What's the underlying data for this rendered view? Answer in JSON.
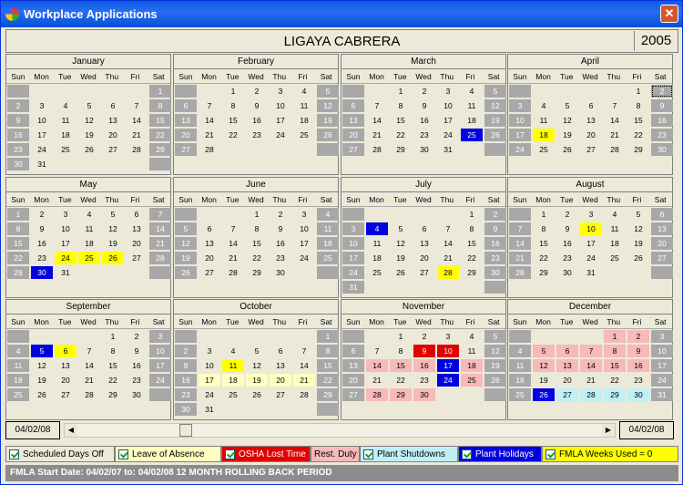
{
  "window": {
    "title": "Workplace Applications",
    "close_label": "✕"
  },
  "header": {
    "employee_name": "LIGAYA CABRERA",
    "year": "2005"
  },
  "day_headers": [
    "Sun",
    "Mon",
    "Tue",
    "Wed",
    "Thu",
    "Fri",
    "Sat"
  ],
  "months": [
    {
      "name": "January",
      "start": 6,
      "days": 31,
      "marks": {}
    },
    {
      "name": "February",
      "start": 2,
      "days": 28,
      "marks": {}
    },
    {
      "name": "March",
      "start": 2,
      "days": 31,
      "marks": {
        "25": "blu"
      }
    },
    {
      "name": "April",
      "start": 5,
      "days": 30,
      "marks": {
        "2": "sel",
        "18": "yel"
      }
    },
    {
      "name": "May",
      "start": 0,
      "days": 31,
      "marks": {
        "24": "yel",
        "25": "yel",
        "26": "yel",
        "30": "blu"
      }
    },
    {
      "name": "June",
      "start": 3,
      "days": 30,
      "marks": {}
    },
    {
      "name": "July",
      "start": 5,
      "days": 31,
      "marks": {
        "4": "blu",
        "28": "yel"
      }
    },
    {
      "name": "August",
      "start": 1,
      "days": 31,
      "marks": {
        "10": "yel"
      }
    },
    {
      "name": "September",
      "start": 4,
      "days": 30,
      "marks": {
        "5": "blu",
        "6": "yel"
      }
    },
    {
      "name": "October",
      "start": 6,
      "days": 31,
      "marks": {
        "11": "yel",
        "17": "lyl",
        "18": "lyl",
        "19": "lyl",
        "20": "lyl",
        "21": "lyl"
      }
    },
    {
      "name": "November",
      "start": 2,
      "days": 30,
      "marks": {
        "9": "red",
        "10": "red",
        "14": "pnk",
        "15": "pnk",
        "16": "pnk",
        "17": "blu",
        "18": "pnk",
        "24": "blu",
        "25": "pnk",
        "28": "pnk",
        "29": "pnk",
        "30": "pnk"
      }
    },
    {
      "name": "December",
      "start": 4,
      "days": 31,
      "marks": {
        "1": "pnk",
        "2": "pnk",
        "5": "pnk",
        "6": "pnk",
        "7": "pnk",
        "8": "pnk",
        "9": "pnk",
        "12": "pnk",
        "13": "pnk",
        "14": "pnk",
        "15": "pnk",
        "16": "pnk",
        "26": "blu",
        "27": "cyn",
        "28": "cyn",
        "29": "cyn",
        "30": "cyn"
      }
    }
  ],
  "scroll": {
    "start_date": "04/02/08",
    "end_date": "04/02/08",
    "left_arrow": "◀",
    "right_arrow": "▶"
  },
  "legend": [
    {
      "label": "Scheduled Days Off",
      "bg": "#ece9d8",
      "fg": "#000000",
      "checkbox": true,
      "w": 120
    },
    {
      "label": "Leave of Absence",
      "bg": "#ffffc0",
      "fg": "#000000",
      "checkbox": true,
      "w": 117
    },
    {
      "label": "OSHA Lost Time",
      "bg": "#e00000",
      "fg": "#ffffff",
      "checkbox": true,
      "w": 98
    },
    {
      "label": "Rest. Duty",
      "bg": "#f7b9b9",
      "fg": "#000000",
      "checkbox": false,
      "w": 54
    },
    {
      "label": "Plant Shutdowns",
      "bg": "#bff0f5",
      "fg": "#000000",
      "checkbox": true,
      "w": 108
    },
    {
      "label": "Plant Holidays",
      "bg": "#0000e0",
      "fg": "#ffffff",
      "checkbox": true,
      "w": 92
    },
    {
      "label": "FMLA Weeks Used = 0",
      "bg": "#ffff00",
      "fg": "#000000",
      "checkbox": true,
      "w": 150
    }
  ],
  "footer": {
    "fmla_text": "FMLA Start Date: 04/02/07 to: 04/02/08 12 MONTH ROLLING BACK PERIOD"
  }
}
